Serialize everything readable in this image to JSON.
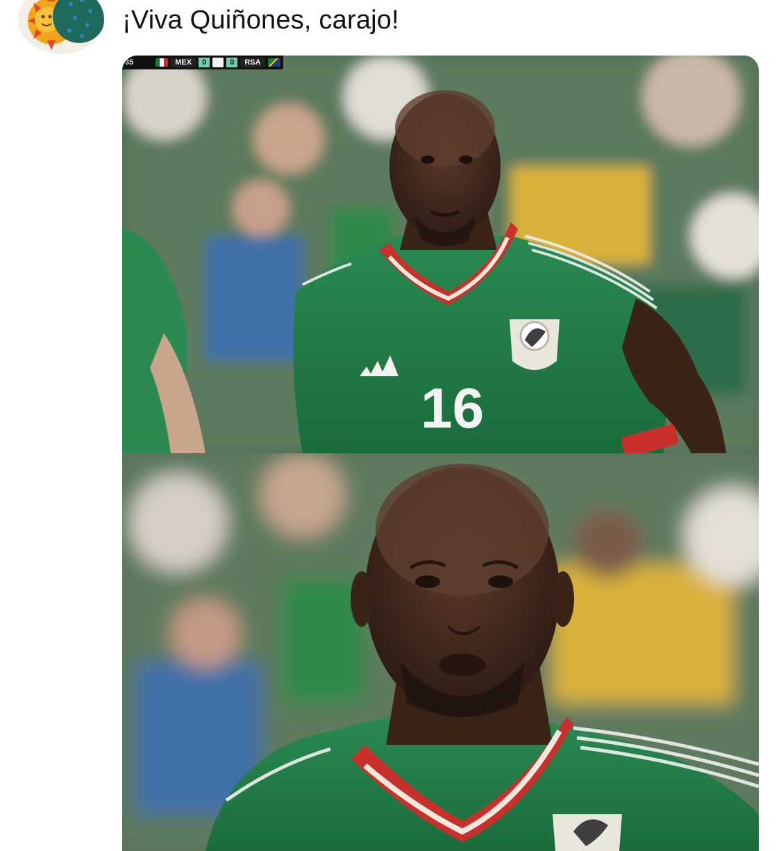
{
  "post": {
    "text": "¡Viva Quiñones, carajo!"
  },
  "avatar": {
    "icon": "sun-and-globe-illustration-icon"
  },
  "scorebug": {
    "clock": "35",
    "home_team": "MEX",
    "home_score": "0",
    "away_score": "0",
    "away_team": "RSA"
  },
  "jersey": {
    "number": "16"
  },
  "colors": {
    "jersey_green": "#1f7a45",
    "collar_red": "#c9302c",
    "crowd_yellow": "#d9b23a",
    "text": "#0f1419",
    "background": "#ffffff"
  }
}
